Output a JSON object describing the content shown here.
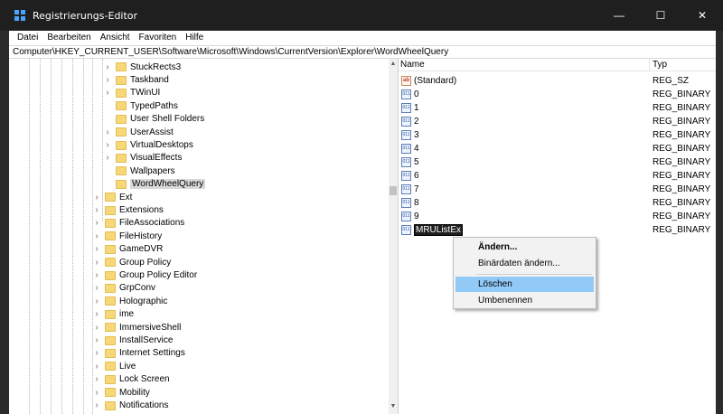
{
  "window": {
    "title": "Registrierungs-Editor",
    "controls": {
      "minimize": "—",
      "maximize": "☐",
      "close": "✕"
    }
  },
  "menu": [
    "Datei",
    "Bearbeiten",
    "Ansicht",
    "Favoriten",
    "Hilfe"
  ],
  "address": "Computer\\HKEY_CURRENT_USER\\Software\\Microsoft\\Windows\\CurrentVersion\\Explorer\\WordWheelQuery",
  "tree": {
    "children_of_explorer": [
      {
        "label": "StuckRects3",
        "expandable": true
      },
      {
        "label": "Taskband",
        "expandable": true
      },
      {
        "label": "TWinUI",
        "expandable": true
      },
      {
        "label": "TypedPaths",
        "expandable": false
      },
      {
        "label": "User Shell Folders",
        "expandable": false
      },
      {
        "label": "UserAssist",
        "expandable": true
      },
      {
        "label": "VirtualDesktops",
        "expandable": true
      },
      {
        "label": "VisualEffects",
        "expandable": true
      },
      {
        "label": "Wallpapers",
        "expandable": false
      },
      {
        "label": "WordWheelQuery",
        "expandable": false,
        "selected": true
      }
    ],
    "siblings": [
      {
        "label": "Ext",
        "expandable": true
      },
      {
        "label": "Extensions",
        "expandable": true
      },
      {
        "label": "FileAssociations",
        "expandable": true
      },
      {
        "label": "FileHistory",
        "expandable": true
      },
      {
        "label": "GameDVR",
        "expandable": true
      },
      {
        "label": "Group Policy",
        "expandable": true
      },
      {
        "label": "Group Policy Editor",
        "expandable": true
      },
      {
        "label": "GrpConv",
        "expandable": true
      },
      {
        "label": "Holographic",
        "expandable": true
      },
      {
        "label": "ime",
        "expandable": true
      },
      {
        "label": "ImmersiveShell",
        "expandable": true
      },
      {
        "label": "InstallService",
        "expandable": true
      },
      {
        "label": "Internet Settings",
        "expandable": true
      },
      {
        "label": "Live",
        "expandable": true
      },
      {
        "label": "Lock Screen",
        "expandable": true
      },
      {
        "label": "Mobility",
        "expandable": true
      },
      {
        "label": "Notifications",
        "expandable": true
      }
    ]
  },
  "list": {
    "columns": {
      "name": "Name",
      "type": "Typ"
    },
    "values": [
      {
        "name": "(Standard)",
        "type": "REG_SZ",
        "icon": "string-value-icon",
        "glyph": "ab"
      },
      {
        "name": "0",
        "type": "REG_BINARY",
        "icon": "binary-value-icon",
        "glyph": "011"
      },
      {
        "name": "1",
        "type": "REG_BINARY",
        "icon": "binary-value-icon",
        "glyph": "011"
      },
      {
        "name": "2",
        "type": "REG_BINARY",
        "icon": "binary-value-icon",
        "glyph": "011"
      },
      {
        "name": "3",
        "type": "REG_BINARY",
        "icon": "binary-value-icon",
        "glyph": "011"
      },
      {
        "name": "4",
        "type": "REG_BINARY",
        "icon": "binary-value-icon",
        "glyph": "011"
      },
      {
        "name": "5",
        "type": "REG_BINARY",
        "icon": "binary-value-icon",
        "glyph": "011"
      },
      {
        "name": "6",
        "type": "REG_BINARY",
        "icon": "binary-value-icon",
        "glyph": "011"
      },
      {
        "name": "7",
        "type": "REG_BINARY",
        "icon": "binary-value-icon",
        "glyph": "011"
      },
      {
        "name": "8",
        "type": "REG_BINARY",
        "icon": "binary-value-icon",
        "glyph": "011"
      },
      {
        "name": "9",
        "type": "REG_BINARY",
        "icon": "binary-value-icon",
        "glyph": "011"
      },
      {
        "name": "MRUListEx",
        "type": "REG_BINARY",
        "icon": "binary-value-icon",
        "glyph": "011",
        "selected": true
      }
    ]
  },
  "context_menu": {
    "items": [
      {
        "label": "Ändern...",
        "bold": true
      },
      {
        "label": "Binärdaten ändern..."
      },
      {
        "label": "Löschen",
        "highlighted": true
      },
      {
        "label": "Umbenennen"
      }
    ]
  },
  "colors": {
    "titlebar": "#1f1f1f",
    "selection": "#d9d9d9",
    "menu_highlight": "#91c9f7",
    "folder": "#f6d878"
  }
}
